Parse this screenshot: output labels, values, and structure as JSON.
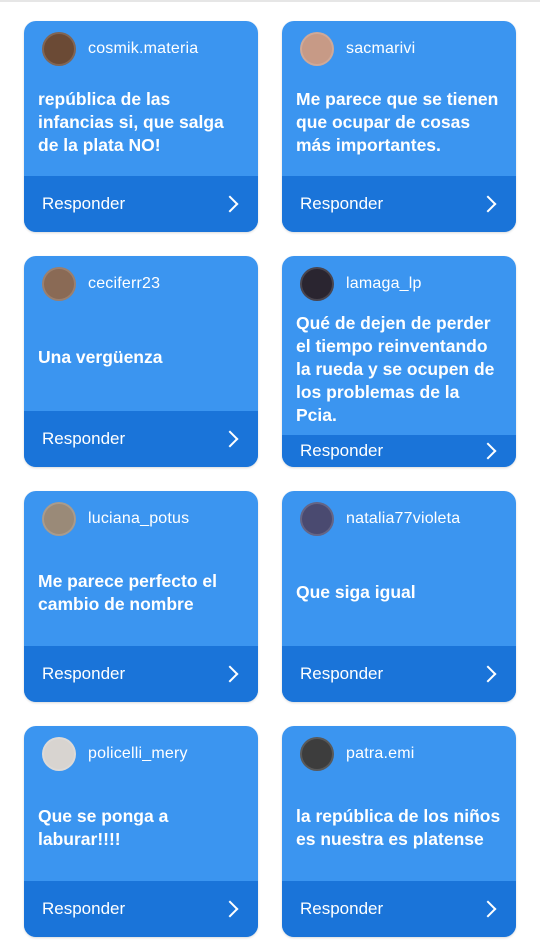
{
  "reply_label": "Responder",
  "cards": [
    {
      "username": "cosmik.materia",
      "message": "república de las infancias si, que salga de la plata NO!",
      "avatar_color": "#6b4a35"
    },
    {
      "username": "sacmarivi",
      "message": "Me parece que se tienen que ocupar de cosas más importantes.",
      "avatar_color": "#c79a86"
    },
    {
      "username": "ceciferr23",
      "message": "Una vergüenza",
      "avatar_color": "#8a6a55"
    },
    {
      "username": "lamaga_lp",
      "message": "Qué de dejen de perder el tiempo reinventando la rueda y se ocupen de los problemas de la Pcia.",
      "avatar_color": "#2a2530"
    },
    {
      "username": "luciana_potus",
      "message": "Me parece perfecto el cambio de nombre",
      "avatar_color": "#9a8a78"
    },
    {
      "username": "natalia77violeta",
      "message": "Que siga igual",
      "avatar_color": "#4a4a70"
    },
    {
      "username": "policelli_mery",
      "message": "Que se ponga a laburar!!!!",
      "avatar_color": "#d8d4d0"
    },
    {
      "username": "patra.emi",
      "message": "la república de los niños es nuestra es platense",
      "avatar_color": "#3d3d3d"
    }
  ]
}
